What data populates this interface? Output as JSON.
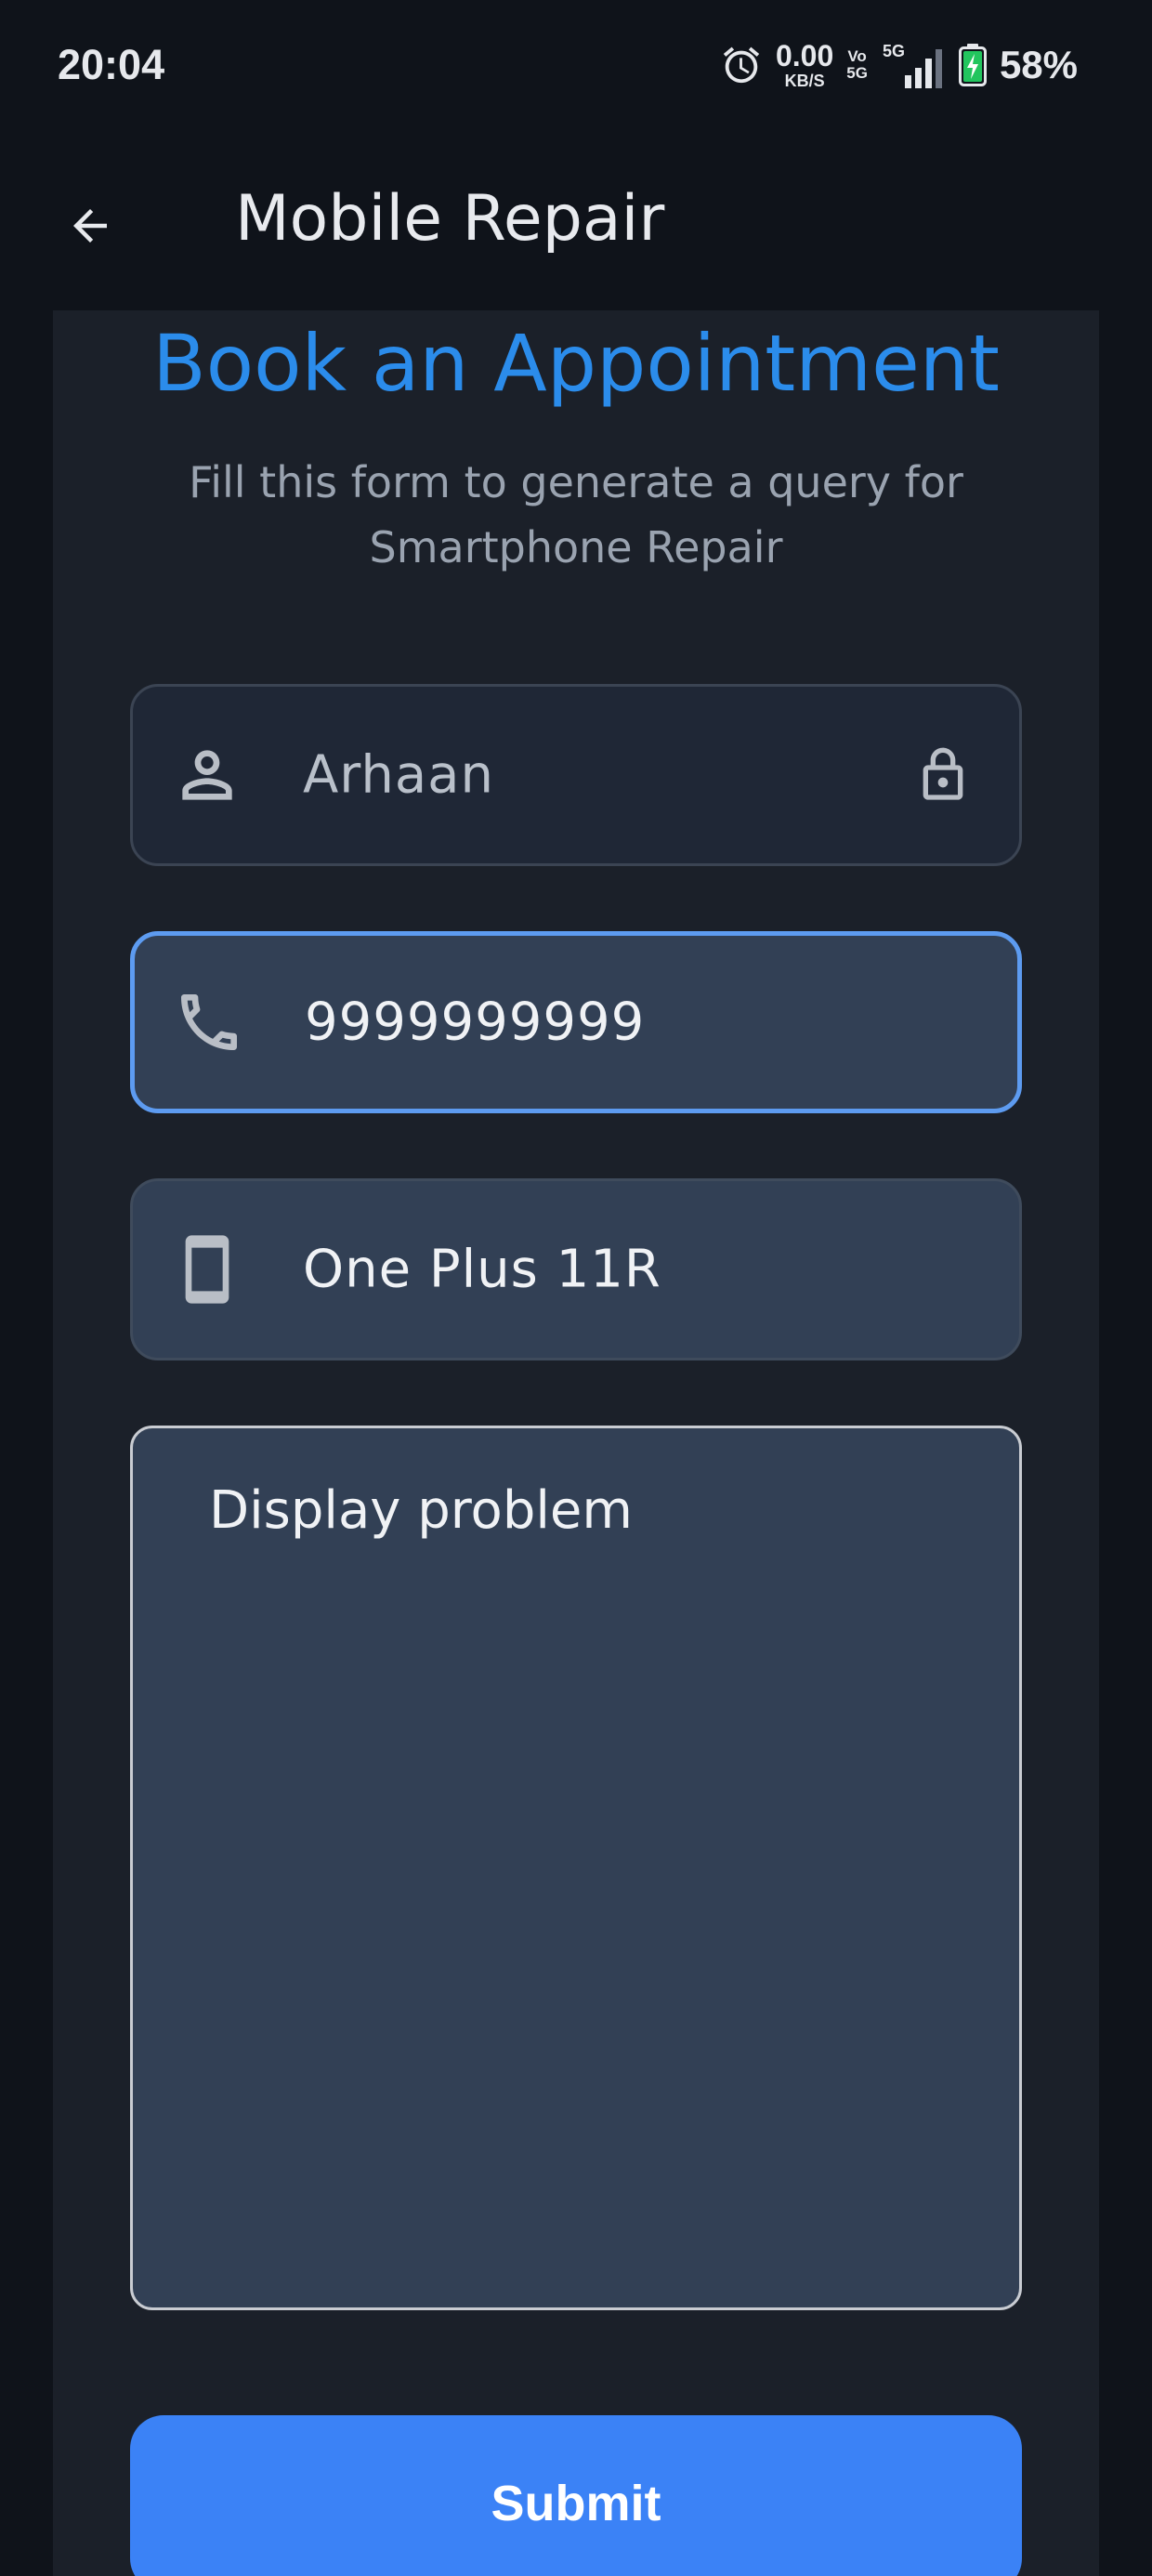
{
  "status_bar": {
    "time": "20:04",
    "net_speed_value": "0.00",
    "net_speed_unit": "KB/S",
    "vo_top": "Vo",
    "vo_bottom": "5G",
    "signal_label": "5G",
    "battery": "58%",
    "icons": [
      "alarm-icon",
      "signal-icon",
      "battery-charging-icon"
    ],
    "battery_color": "#22c55e"
  },
  "app_bar": {
    "title": "Mobile Repair",
    "back_icon": "arrow-left-icon"
  },
  "form": {
    "heading": "Book an Appointment",
    "subheading": "Fill this form to generate a query for Smartphone Repair",
    "name": {
      "value": "Arhaan",
      "icon": "person-icon",
      "trailing_icon": "lock-icon"
    },
    "phone": {
      "value": "9999999999",
      "icon": "phone-icon"
    },
    "model": {
      "value": "One Plus 11R",
      "icon": "smartphone-icon"
    },
    "problem": {
      "value": "Display problem"
    },
    "submit_label": "Submit"
  },
  "colors": {
    "heading": "#2b8ceb",
    "accent": "#3b82f6",
    "focus_border": "#5d9bf0",
    "background": "#0f131a",
    "card": "#1b2029"
  }
}
